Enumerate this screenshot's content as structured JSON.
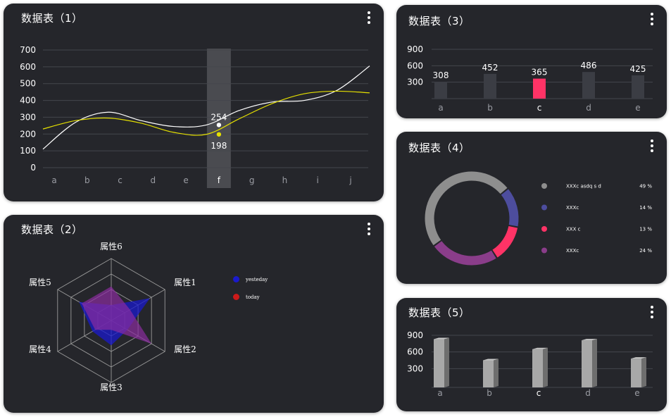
{
  "cards": {
    "c1": {
      "title": "数据表（1）"
    },
    "c2": {
      "title": "数据表（2）"
    },
    "c3": {
      "title": "数据表（3）"
    },
    "c4": {
      "title": "数据表（4）"
    },
    "c5": {
      "title": "数据表（5）"
    }
  },
  "colors": {
    "card_bg": "#25262b",
    "white_line": "#ffffff",
    "yellow_line": "#e5e000",
    "bar_dark": "#3b3d44",
    "bar_highlight": "#ff3366",
    "grid": "#44464d",
    "axis_label": "#9a9ca3",
    "radar_blue": "#1a1acc",
    "radar_purple": "#8a2ca0",
    "donut": [
      "#8e8e8e",
      "#4d4d9e",
      "#ff3366",
      "#8a3d8a"
    ],
    "bar3d": "#a8a8a8"
  },
  "chart_data": [
    {
      "id": "chart1",
      "type": "line",
      "categories": [
        "a",
        "b",
        "c",
        "d",
        "e",
        "f",
        "g",
        "h",
        "i",
        "j"
      ],
      "yticks": [
        0,
        100,
        200,
        300,
        400,
        500,
        600,
        700
      ],
      "ylim": [
        0,
        700
      ],
      "series": [
        {
          "color": "#ffffff",
          "values": [
            110,
            270,
            330,
            280,
            245,
            254,
            340,
            390,
            400,
            460,
            605
          ]
        },
        {
          "color": "#e5e000",
          "values": [
            230,
            280,
            295,
            265,
            210,
            198,
            290,
            380,
            440,
            455,
            445
          ]
        }
      ],
      "highlight_index": 5,
      "highlight_labels": [
        "254",
        "198"
      ]
    },
    {
      "id": "chart2",
      "type": "radar",
      "indicators": [
        "属性1",
        "属性2",
        "属性3",
        "属性4",
        "属性5",
        "属性6"
      ],
      "max": 100,
      "series": [
        {
          "name": "yesteday",
          "color": "#1a1acc",
          "values": [
            72,
            30,
            40,
            35,
            60,
            25
          ]
        },
        {
          "name": "today",
          "color": "#8a2ca0",
          "values": [
            35,
            75,
            15,
            30,
            55,
            55
          ]
        }
      ]
    },
    {
      "id": "chart3",
      "type": "bar",
      "categories": [
        "a",
        "b",
        "c",
        "d",
        "e"
      ],
      "values": [
        308,
        452,
        365,
        486,
        425
      ],
      "highlight_index": 2,
      "yticks": [
        300,
        600,
        900
      ],
      "ylim": [
        0,
        900
      ]
    },
    {
      "id": "chart4",
      "type": "pie",
      "slices": [
        {
          "label": "XXXc asdq s d",
          "value": 49,
          "pct": "49 %",
          "color": "#8e8e8e"
        },
        {
          "label": "XXXc",
          "value": 14,
          "pct": "14 %",
          "color": "#4d4d9e"
        },
        {
          "label": "XXX c",
          "value": 13,
          "pct": "13 %",
          "color": "#ff3366"
        },
        {
          "label": "XXXc",
          "value": 24,
          "pct": "24 %",
          "color": "#8a3d8a"
        }
      ]
    },
    {
      "id": "chart5",
      "type": "bar",
      "categories": [
        "a",
        "b",
        "c",
        "d",
        "e"
      ],
      "values": [
        830,
        450,
        650,
        810,
        480
      ],
      "highlight_index": 2,
      "yticks": [
        300,
        600,
        900
      ],
      "ylim": [
        0,
        900
      ]
    }
  ]
}
